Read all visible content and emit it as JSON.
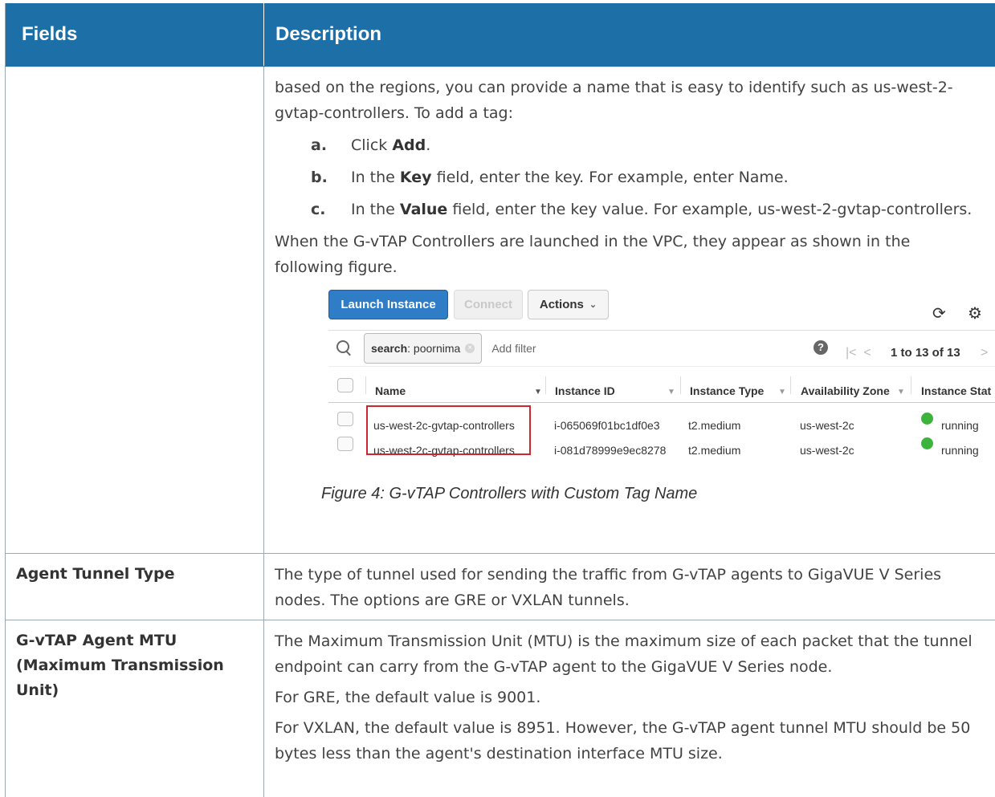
{
  "header": {
    "fields": "Fields",
    "description": "Description"
  },
  "row1": {
    "intro": "based on the regions, you can provide a name that is easy to identify such as us-west-2-gvtap-controllers. To add a tag:",
    "steps": [
      {
        "letter": "a.",
        "pre": "Click ",
        "bold": "Add",
        "post": "."
      },
      {
        "letter": "b.",
        "pre": "In the ",
        "bold": "Key",
        "post": " field, enter the key. For example, enter Name."
      },
      {
        "letter": "c.",
        "pre": "In the ",
        "bold": "Value",
        "post": " field, enter the key value. For example, us-west-2-gvtap-controllers."
      }
    ],
    "after": "When the G-vTAP Controllers are launched in the VPC, they appear as shown in the following figure.",
    "caption": "Figure 4: G-vTAP Controllers with Custom Tag Name"
  },
  "figure": {
    "buttons": {
      "launch": "Launch Instance",
      "connect": "Connect",
      "actions": "Actions"
    },
    "search_key": "search",
    "search_value": " : poornima",
    "add_filter": "Add filter",
    "pager": "1 to 13 of 13",
    "columns": [
      "Name",
      "Instance ID",
      "Instance Type",
      "Availability Zone",
      "Instance Stat"
    ],
    "rows": [
      {
        "name": "us-west-2c-gvtap-controllers",
        "id": "i-065069f01bc1df0e3",
        "type": "t2.medium",
        "zone": "us-west-2c",
        "state": "running"
      },
      {
        "name": "us-west-2c-gvtap-controllers",
        "id": "i-081d78999e9ec8278",
        "type": "t2.medium",
        "zone": "us-west-2c",
        "state": "running"
      }
    ]
  },
  "row2": {
    "field": "Agent Tunnel Type",
    "desc": "The type of tunnel used for sending the traffic from G-vTAP agents to GigaVUE V Series nodes. The options are GRE or VXLAN tunnels."
  },
  "row3": {
    "field": "G-vTAP Agent MTU (Maximum Transmission Unit)",
    "p1": "The Maximum Transmission Unit (MTU) is the maximum size of each packet that the tunnel endpoint can carry from the G-vTAP agent to the GigaVUE V Series node.",
    "p2": "For GRE, the default value is 9001.",
    "p3": "For VXLAN, the default value is 8951. However, the G-vTAP agent tunnel MTU should be 50 bytes less than the agent's destination interface MTU size."
  }
}
